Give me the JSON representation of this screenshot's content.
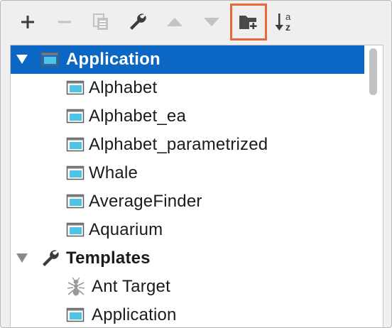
{
  "toolbar": {
    "buttons": [
      {
        "icon": "add-icon",
        "enabled": true
      },
      {
        "icon": "remove-icon",
        "enabled": false
      },
      {
        "icon": "copy-icon",
        "enabled": false
      },
      {
        "icon": "wrench-icon",
        "enabled": true
      },
      {
        "icon": "move-up-icon",
        "enabled": false
      },
      {
        "icon": "move-down-icon",
        "enabled": false
      },
      {
        "icon": "new-folder-icon",
        "enabled": true,
        "selected": true
      },
      {
        "icon": "sort-alphabetically-icon",
        "enabled": true
      }
    ],
    "sort_label_top": "a",
    "sort_label_bottom": "z"
  },
  "tree": {
    "application": {
      "label": "Application",
      "expanded": true,
      "selected": true,
      "children": [
        {
          "label": "Alphabet"
        },
        {
          "label": "Alphabet_ea"
        },
        {
          "label": "Alphabet_parametrized"
        },
        {
          "label": "Whale"
        },
        {
          "label": "AverageFinder"
        },
        {
          "label": "Aquarium"
        }
      ]
    },
    "templates": {
      "label": "Templates",
      "expanded": true,
      "children": [
        {
          "label": "Ant Target",
          "icon": "ant-icon"
        },
        {
          "label": "Application",
          "icon": "application-config-icon"
        }
      ]
    }
  },
  "colors": {
    "selection": "#0b67c3",
    "highlight_border": "#e8683b",
    "config_icon": "#4fc4e8"
  }
}
